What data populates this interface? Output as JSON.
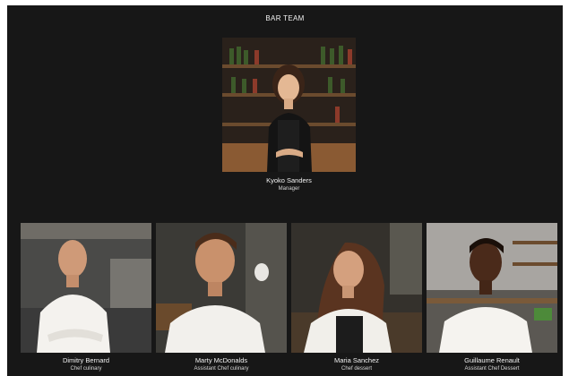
{
  "section": {
    "title": "BAR TEAM"
  },
  "manager": {
    "name": "Kyoko Sanders",
    "role": "Manager"
  },
  "team": [
    {
      "name": "Dimitry Bernard",
      "role": "Chef culinary"
    },
    {
      "name": "Marty McDonalds",
      "role": "Assistant Chef culinary"
    },
    {
      "name": "Maria Sanchez",
      "role": "Chef dessert"
    },
    {
      "name": "Guillaume Renault",
      "role": "Assistant Chef Dessert"
    }
  ],
  "colors": {
    "background": "#171717",
    "text": "#f2f2f2",
    "page": "#ffffff"
  }
}
